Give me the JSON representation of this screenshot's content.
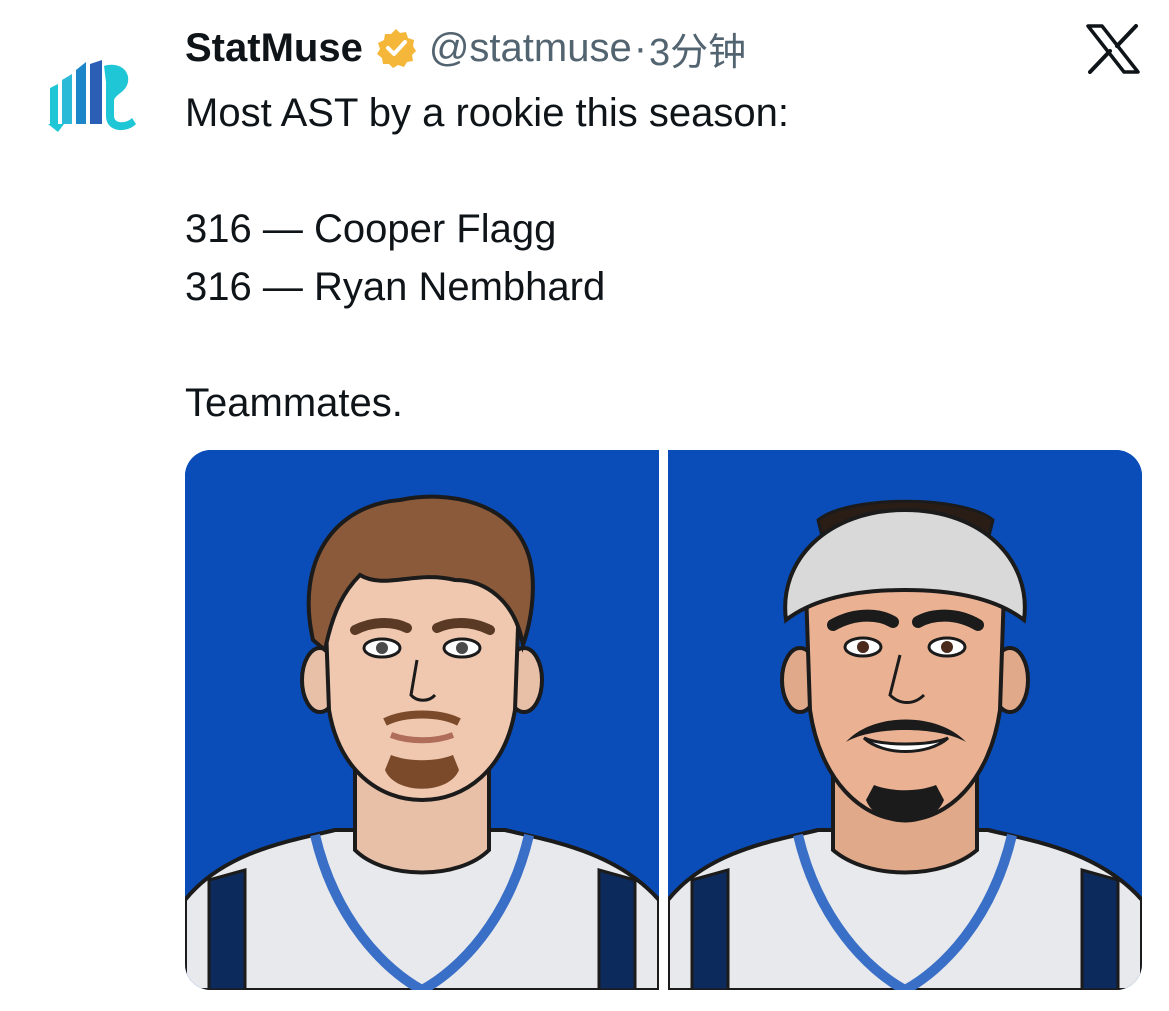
{
  "tweet": {
    "display_name": "StatMuse",
    "handle": "@statmuse",
    "separator": "·",
    "time": "3分钟",
    "lines": [
      "Most AST by a rookie this season:",
      "",
      "316 — Cooper Flagg",
      "316 — Ryan Nembhard",
      "",
      "Teammates."
    ]
  },
  "icons": {
    "avatar": "statmuse-logo",
    "verified": "verified-badge-icon",
    "platform": "x-logo"
  },
  "colors": {
    "panel_background": "#0a4db8",
    "verified_gold": "#f4b73a",
    "logo_teal": "#1ec6d6",
    "handle_gray": "#536471"
  },
  "media": {
    "images": [
      {
        "subject": "Cooper Flagg"
      },
      {
        "subject": "Ryan Nembhard"
      }
    ]
  }
}
